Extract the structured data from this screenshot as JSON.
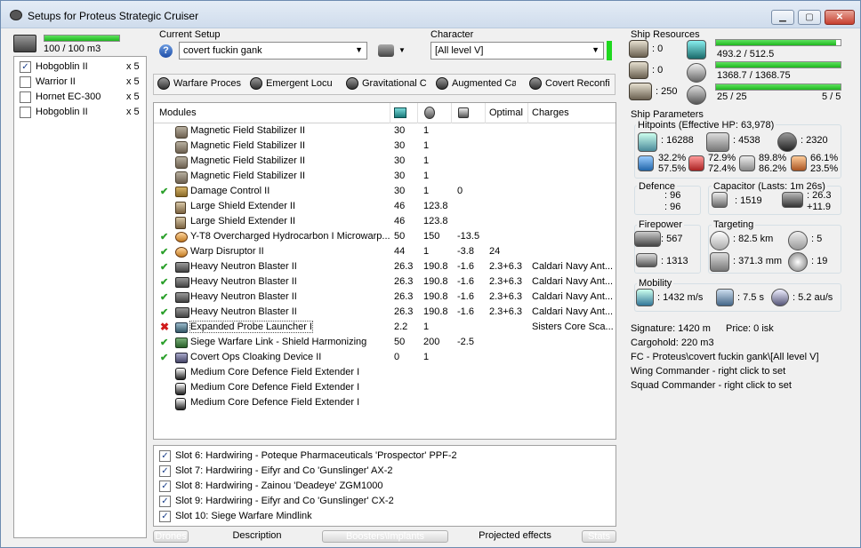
{
  "window": {
    "title": "Setups for Proteus Strategic Cruiser",
    "minimize": "▁",
    "maximize": "▢",
    "close": "✕"
  },
  "left": {
    "drones_capacity": "100 / 100 m3",
    "drones_fill": 1.0,
    "drones": [
      {
        "name": "Hobgoblin II",
        "qty": "x 5",
        "checked": true
      },
      {
        "name": "Warrior II",
        "qty": "x 5",
        "checked": false
      },
      {
        "name": "Hornet EC-300",
        "qty": "x 5",
        "checked": false
      },
      {
        "name": "Hobgoblin II",
        "qty": "x 5",
        "checked": false
      }
    ]
  },
  "setup": {
    "label": "Current Setup",
    "value": "covert fuckin gank",
    "help": "?"
  },
  "character": {
    "label": "Character",
    "value": "[All level V]"
  },
  "subsystems": [
    "Warfare Proces",
    "Emergent Locu",
    "Gravitational C",
    "Augmented Ca",
    "Covert Reconfi"
  ],
  "modules_header": {
    "modules": "Modules",
    "optimal": "Optimal",
    "charges": "Charges"
  },
  "modules": [
    {
      "status": "",
      "icon": "mag-stab-icon",
      "name": "Magnetic Field Stabilizer II",
      "cpu": "30",
      "pg": "1",
      "cap": "",
      "optimal": "",
      "charges": ""
    },
    {
      "status": "",
      "icon": "mag-stab-icon",
      "name": "Magnetic Field Stabilizer II",
      "cpu": "30",
      "pg": "1",
      "cap": "",
      "optimal": "",
      "charges": ""
    },
    {
      "status": "",
      "icon": "mag-stab-icon",
      "name": "Magnetic Field Stabilizer II",
      "cpu": "30",
      "pg": "1",
      "cap": "",
      "optimal": "",
      "charges": ""
    },
    {
      "status": "",
      "icon": "mag-stab-icon",
      "name": "Magnetic Field Stabilizer II",
      "cpu": "30",
      "pg": "1",
      "cap": "",
      "optimal": "",
      "charges": ""
    },
    {
      "status": "ok",
      "icon": "damage-control-icon",
      "name": "Damage Control II",
      "cpu": "30",
      "pg": "1",
      "cap": "0",
      "optimal": "",
      "charges": ""
    },
    {
      "status": "",
      "icon": "shield-extender-icon",
      "name": "Large Shield Extender II",
      "cpu": "46",
      "pg": "123.8",
      "cap": "",
      "optimal": "",
      "charges": ""
    },
    {
      "status": "",
      "icon": "shield-extender-icon",
      "name": "Large Shield Extender II",
      "cpu": "46",
      "pg": "123.8",
      "cap": "",
      "optimal": "",
      "charges": ""
    },
    {
      "status": "ok",
      "icon": "microwarpdrive-icon",
      "name": "Y-T8 Overcharged Hydrocarbon I Microwarp...",
      "cpu": "50",
      "pg": "150",
      "cap": "-13.5",
      "optimal": "",
      "charges": ""
    },
    {
      "status": "ok",
      "icon": "warp-disruptor-icon",
      "name": "Warp Disruptor II",
      "cpu": "44",
      "pg": "1",
      "cap": "-3.8",
      "optimal": "24",
      "charges": ""
    },
    {
      "status": "ok",
      "icon": "blaster-icon",
      "name": "Heavy Neutron Blaster II",
      "cpu": "26.3",
      "pg": "190.8",
      "cap": "-1.6",
      "optimal": "2.3+6.3",
      "charges": "Caldari Navy Ant..."
    },
    {
      "status": "ok",
      "icon": "blaster-icon",
      "name": "Heavy Neutron Blaster II",
      "cpu": "26.3",
      "pg": "190.8",
      "cap": "-1.6",
      "optimal": "2.3+6.3",
      "charges": "Caldari Navy Ant..."
    },
    {
      "status": "ok",
      "icon": "blaster-icon",
      "name": "Heavy Neutron Blaster II",
      "cpu": "26.3",
      "pg": "190.8",
      "cap": "-1.6",
      "optimal": "2.3+6.3",
      "charges": "Caldari Navy Ant..."
    },
    {
      "status": "ok",
      "icon": "blaster-icon",
      "name": "Heavy Neutron Blaster II",
      "cpu": "26.3",
      "pg": "190.8",
      "cap": "-1.6",
      "optimal": "2.3+6.3",
      "charges": "Caldari Navy Ant..."
    },
    {
      "status": "bad",
      "icon": "probe-launcher-icon",
      "name": "Expanded Probe Launcher I",
      "cpu": "2.2",
      "pg": "1",
      "cap": "",
      "optimal": "",
      "charges": "Sisters Core Sca..."
    },
    {
      "status": "ok",
      "icon": "warfare-link-icon",
      "name": "Siege Warfare Link - Shield Harmonizing",
      "cpu": "50",
      "pg": "200",
      "cap": "-2.5",
      "optimal": "",
      "charges": ""
    },
    {
      "status": "ok",
      "icon": "cloak-icon",
      "name": "Covert Ops Cloaking Device II",
      "cpu": "0",
      "pg": "1",
      "cap": "",
      "optimal": "",
      "charges": ""
    },
    {
      "status": "",
      "icon": "rig-icon",
      "name": "Medium Core Defence Field Extender I",
      "cpu": "",
      "pg": "",
      "cap": "",
      "optimal": "",
      "charges": ""
    },
    {
      "status": "",
      "icon": "rig-icon",
      "name": "Medium Core Defence Field Extender I",
      "cpu": "",
      "pg": "",
      "cap": "",
      "optimal": "",
      "charges": ""
    },
    {
      "status": "",
      "icon": "rig-icon",
      "name": "Medium Core Defence Field Extender I",
      "cpu": "",
      "pg": "",
      "cap": "",
      "optimal": "",
      "charges": ""
    }
  ],
  "implants": [
    "Slot 6: Hardwiring - Poteque Pharmaceuticals 'Prospector' PPF-2",
    "Slot 7: Hardwiring - Eifyr and Co 'Gunslinger' AX-2",
    "Slot 8: Hardwiring - Zainou 'Deadeye' ZGM1000",
    "Slot 9: Hardwiring - Eifyr and Co 'Gunslinger' CX-2",
    "Slot 10: Siege Warfare Mindlink"
  ],
  "bottom_tabs": [
    "Drones",
    "Description",
    "Boosters\\Implants",
    "Projected effects",
    "Stats"
  ],
  "resources": {
    "title": "Ship Resources",
    "turret": ": 0",
    "launcher": ": 0",
    "calibration": ": 250",
    "cpu": "493.2 / 512.5",
    "cpu_fill": 0.962,
    "powergrid": "1368.7 / 1368.75",
    "powergrid_fill": 1.0,
    "drone_bw": "25 / 25",
    "drone_bw_fill": 1.0,
    "drones_active": "5 / 5"
  },
  "params": {
    "title": "Ship Parameters",
    "hitpoints_title": "Hitpoints (Effective HP: 63,978)",
    "shield_hp": ": 16288",
    "armor_hp": ": 4538",
    "hull_hp": ": 2320",
    "res_em_a": "32.2%",
    "res_em_b": "57.5%",
    "res_th_a": "72.9%",
    "res_th_b": "72.4%",
    "res_ki_a": "89.8%",
    "res_ki_b": "86.2%",
    "res_ex_a": "66.1%",
    "res_ex_b": "23.5%",
    "defence_title": "Defence",
    "defence_a": ": 96",
    "defence_b": ": 96",
    "capacitor_title": "Capacitor (Lasts: 1m 26s)",
    "capacitor": ": 1519",
    "cap_recharge_a": ": 26.3",
    "cap_recharge_b": "+11.9",
    "firepower_title": "Firepower",
    "dps": ": 567",
    "volley": ": 1313",
    "targeting_title": "Targeting",
    "target_range": ": 82.5 km",
    "max_targets": ": 5",
    "scan_res": ": 371.3 mm",
    "sensor_strength": ": 19",
    "mobility_title": "Mobility",
    "velocity": ": 1432 m/s",
    "align_time": ": 7.5 s",
    "warp_speed": ": 5.2 au/s",
    "signature": "Signature: 1420 m",
    "price": "Price: 0 isk",
    "cargohold": "Cargohold: 220 m3",
    "fc": "FC - Proteus\\covert fuckin gank\\[All level V]",
    "wing": "Wing Commander - right click to set",
    "squad": "Squad Commander - right click to set"
  },
  "colors": {
    "bar_green": "#1fb61f",
    "ok": "#2ca02c",
    "bad": "#d01a1a",
    "title_bg": "#dbe5f1"
  }
}
